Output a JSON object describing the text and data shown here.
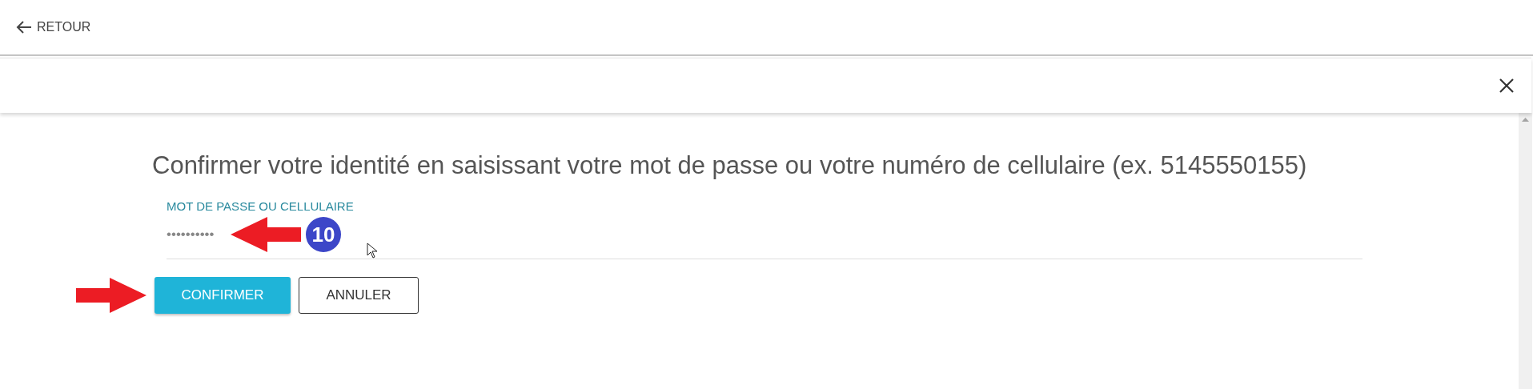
{
  "back_link": {
    "label": "RETOUR"
  },
  "dialog": {
    "heading": "Confirmer votre identité en saisissant votre mot de passe ou votre numéro de cellulaire (ex. 5145550155)",
    "field": {
      "label": "MOT DE PASSE OU CELLULAIRE",
      "value": "••••••••••"
    },
    "step_badge": "10",
    "buttons": [
      {
        "label": "CONFIRMER",
        "kind": "primary"
      },
      {
        "label": "ANNULER",
        "kind": "secondary"
      }
    ]
  }
}
